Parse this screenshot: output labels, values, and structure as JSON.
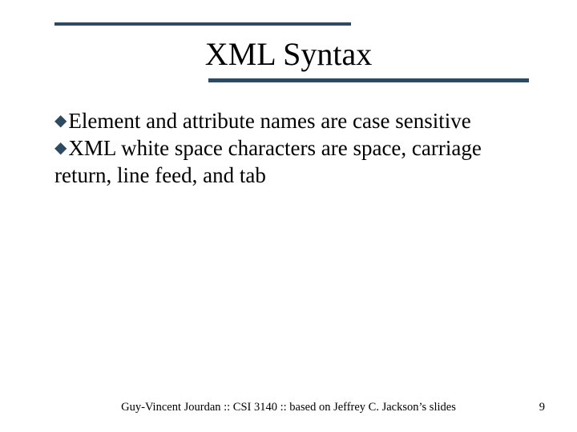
{
  "title": "XML Syntax",
  "bullets": [
    "Element and attribute names are case sensitive",
    "XML white space characters are space, carriage return, line feed, and tab"
  ],
  "footer": "Guy-Vincent Jourdan :: CSI 3140 :: based on Jeffrey C. Jackson’s slides",
  "page": "9"
}
